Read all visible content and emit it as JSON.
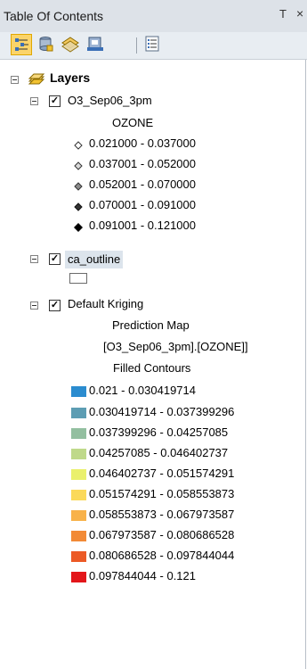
{
  "window": {
    "title": "Table Of Contents",
    "pin_glyph": "Т",
    "close_glyph": "×"
  },
  "toolbar": {
    "tools": [
      {
        "icon": "list-by-drawing-order-icon",
        "active": true
      },
      {
        "icon": "list-by-source-icon",
        "active": false
      },
      {
        "icon": "list-by-visibility-icon",
        "active": false
      },
      {
        "icon": "list-by-selection-icon",
        "active": false
      },
      {
        "icon": "options-icon",
        "active": false
      }
    ]
  },
  "layers_root": {
    "label": "Layers",
    "icon": "layers-icon"
  },
  "layers": [
    {
      "name": "O3_Sep06_3pm",
      "checked": true,
      "field": "OZONE",
      "classes": [
        "0.021000 - 0.037000",
        "0.037001 - 0.052000",
        "0.052001 - 0.070000",
        "0.070001 - 0.091000",
        "0.091001 - 0.121000"
      ]
    },
    {
      "name": "ca_outline",
      "checked": true,
      "selected": true
    },
    {
      "name": "Default Kriging",
      "checked": true,
      "renderer_lines": [
        "Prediction Map",
        "[O3_Sep06_3pm].[OZONE]]",
        "Filled Contours"
      ],
      "classes": [
        {
          "label": "0.021 - 0.030419714",
          "color": "#2b8ccf"
        },
        {
          "label": "0.030419714 - 0.037399296",
          "color": "#5d9db3"
        },
        {
          "label": "0.037399296 - 0.04257085",
          "color": "#93bfa0"
        },
        {
          "label": "0.04257085 - 0.046402737",
          "color": "#bfd98a"
        },
        {
          "label": "0.046402737 - 0.051574291",
          "color": "#eaf06c"
        },
        {
          "label": "0.051574291 - 0.058553873",
          "color": "#fbd95a"
        },
        {
          "label": "0.058553873 - 0.067973587",
          "color": "#f8b24a"
        },
        {
          "label": "0.067973587 - 0.080686528",
          "color": "#f28a36"
        },
        {
          "label": "0.080686528 - 0.097844044",
          "color": "#ec5a26"
        },
        {
          "label": "0.097844044 - 0.121",
          "color": "#e3161a"
        }
      ]
    }
  ]
}
